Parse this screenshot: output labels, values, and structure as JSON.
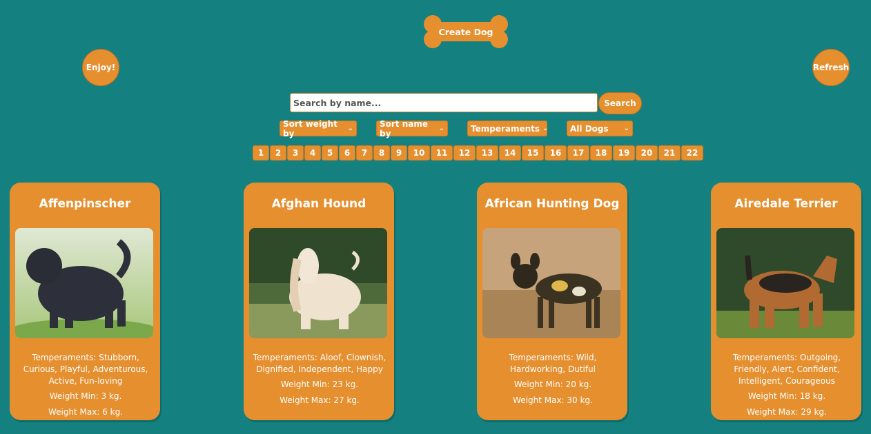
{
  "header": {
    "create_label": "Create Dog",
    "enjoy_label": "Enjoy!",
    "refresh_label": "Refresh"
  },
  "search": {
    "placeholder": "Search by name...",
    "value": "",
    "button_label": "Search"
  },
  "filters": {
    "sort_weight": "Sort weight by",
    "sort_name": "Sort name by",
    "temperaments": "Temperaments",
    "source": "All Dogs"
  },
  "pagination": {
    "pages": [
      "1",
      "2",
      "3",
      "4",
      "5",
      "6",
      "7",
      "8",
      "9",
      "10",
      "11",
      "12",
      "13",
      "14",
      "15",
      "16",
      "17",
      "18",
      "19",
      "20",
      "21",
      "22"
    ]
  },
  "cards": [
    {
      "name": "Affenpinscher",
      "temperaments": "Temperaments: Stubborn, Curious, Playful, Adventurous, Active, Fun-loving",
      "weight_min": "Weight Min: 3 kg.",
      "weight_max": "Weight Max: 6 kg."
    },
    {
      "name": "Afghan Hound",
      "temperaments": "Temperaments: Aloof, Clownish, Dignified, Independent, Happy",
      "weight_min": "Weight Min: 23 kg.",
      "weight_max": "Weight Max: 27 kg."
    },
    {
      "name": "African Hunting Dog",
      "temperaments": "Temperaments: Wild, Hardworking, Dutiful",
      "weight_min": "Weight Min: 20 kg.",
      "weight_max": "Weight Max: 30 kg."
    },
    {
      "name": "Airedale Terrier",
      "temperaments": "Temperaments: Outgoing, Friendly, Alert, Confident, Intelligent, Courageous",
      "weight_min": "Weight Min: 18 kg.",
      "weight_max": "Weight Max: 29 kg."
    }
  ],
  "colors": {
    "background": "#148080",
    "accent": "#e58f2f"
  }
}
